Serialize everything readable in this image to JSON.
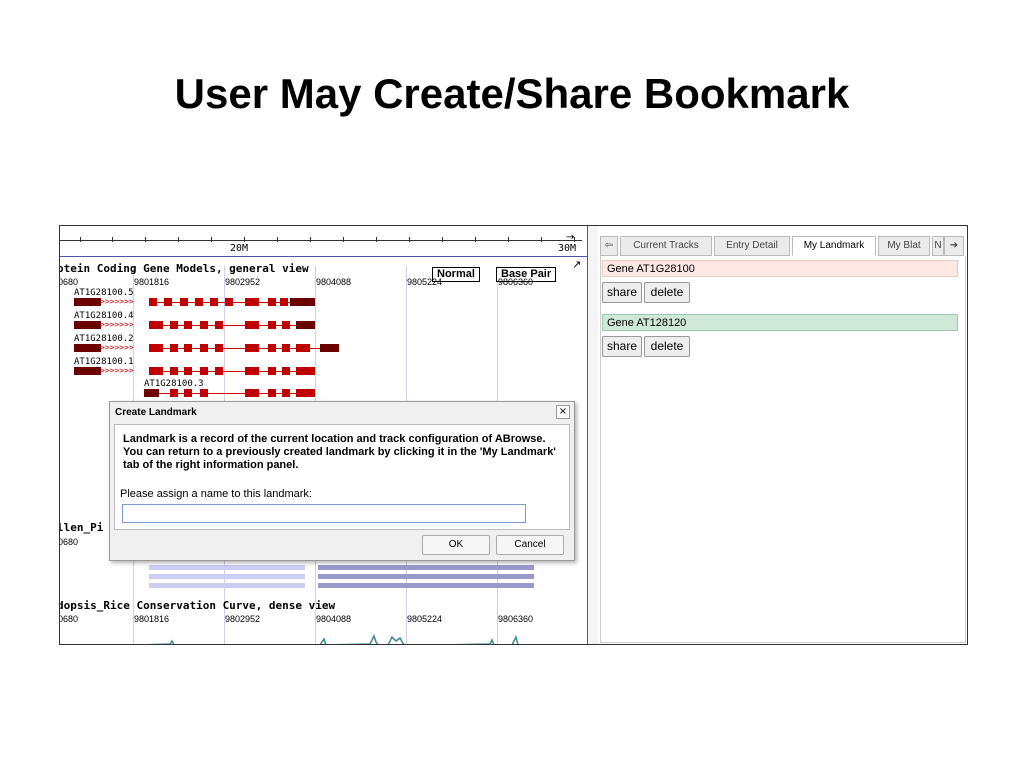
{
  "slide": {
    "title": "User May Create/Share Bookmark"
  },
  "ruler": {
    "label_20m": "20M",
    "label_30m": "30M"
  },
  "track1": {
    "title": "otein Coding Gene Models, general view",
    "coords": [
      "0680",
      "9801816",
      "9802952",
      "9804088",
      "9805224",
      "9806360"
    ],
    "normal_btn": "Normal",
    "basepair_btn": "Base Pair",
    "genes": [
      "AT1G28100.5",
      "AT1G28100.4",
      "AT1G28100.2",
      "AT1G28100.1",
      "AT1G28100.3"
    ]
  },
  "track2": {
    "title": "llen_Pi",
    "coord0": "0680"
  },
  "track3": {
    "title": "dopsis_Rice Conservation Curve, dense view",
    "coords": [
      "0680",
      "9801816",
      "9802952",
      "9804088",
      "9805224",
      "9806360"
    ]
  },
  "dialog": {
    "title": "Create Landmark",
    "close": "×",
    "description": "Landmark is a record of the current location and track configuration of ABrowse. You can return to a previously created landmark by clicking it in the 'My Landmark' tab of the right information panel.",
    "prompt": "Please assign a name to this landmark:",
    "input_value": "",
    "ok": "OK",
    "cancel": "Cancel"
  },
  "panel": {
    "tabs": [
      "Current Tracks",
      "Entry Detail",
      "My Landmark",
      "My Blat",
      "N"
    ],
    "active_tab": "My Landmark",
    "landmarks": [
      {
        "name": "Gene AT1G28100",
        "color": "#fde8e4"
      },
      {
        "name": "Gene AT128120",
        "color": "#cfe8d8"
      }
    ],
    "share": "share",
    "delete": "delete"
  },
  "colors": {
    "exon_dark": "#6b0000",
    "exon": "#c00000",
    "blue_light": "#ccccf4",
    "blue_dark": "#9999cc"
  }
}
